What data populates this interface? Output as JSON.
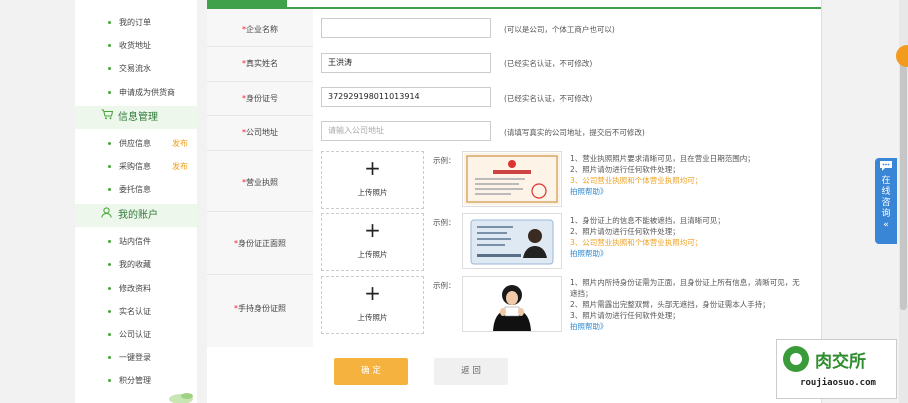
{
  "sidebar": {
    "top_items": [
      {
        "label": "我的订单"
      },
      {
        "label": "收货地址"
      },
      {
        "label": "交易流水"
      },
      {
        "label": "申请成为供货商"
      }
    ],
    "info_section": {
      "heading": "信息管理",
      "icon": "cart-icon",
      "items": [
        {
          "label": "供应信息",
          "action": "发布"
        },
        {
          "label": "采购信息",
          "action": "发布"
        },
        {
          "label": "委托信息",
          "action": ""
        }
      ]
    },
    "account_section": {
      "heading": "我的账户",
      "icon": "user-icon",
      "items": [
        {
          "label": "站内信件"
        },
        {
          "label": "我的收藏"
        },
        {
          "label": "修改资料"
        },
        {
          "label": "实名认证"
        },
        {
          "label": "公司认证"
        },
        {
          "label": "一键登录"
        },
        {
          "label": "积分管理"
        }
      ]
    }
  },
  "form": {
    "company_name": {
      "label": "企业名称",
      "value": "",
      "hint": "(可以是公司，个体工商户也可以)"
    },
    "real_name": {
      "label": "真实姓名",
      "value": "王洪涛",
      "hint": "(已经实名认证，不可修改)"
    },
    "id_number": {
      "label": "身份证号",
      "value": "372929198011013914",
      "hint": "(已经实名认证，不可修改)"
    },
    "company_address": {
      "label": "公司地址",
      "placeholder": "请输入公司地址",
      "hint": "(请填写真实的公司地址，提交后不可修改)"
    },
    "business_license": {
      "label": "营业执照",
      "upload_text": "上传照片",
      "example_label": "示例：",
      "req1": "1、营业执照照片要求清晰可见，且在营业日期范围内；",
      "req2": "2、照片请勿进行任何软件处理；",
      "req3": "3、公司营业执照和个体营业执照均可；",
      "help": "拍照帮助》"
    },
    "id_front": {
      "label": "身份证正面照",
      "upload_text": "上传照片",
      "example_label": "示例：",
      "req1": "1、身份证上的信息不能被遮挡，且清晰可见；",
      "req2": "2、照片请勿进行任何软件处理；",
      "req3": "3、公司营业执照和个体营业执照均可；",
      "help": "拍照帮助》"
    },
    "handheld_id": {
      "label": "手持身份证照",
      "upload_text": "上传照片",
      "example_label": "示例：",
      "req1": "1、照片内所持身份证需为正面，且身份证上所有信息，清晰可见，无遮挡；",
      "req2": "2、照片需露出完整双臂，头部无遮挡，身份证需本人手持；",
      "req3": "3、照片请勿进行任何软件处理；",
      "help": "拍照帮助》"
    },
    "required_mark": "*"
  },
  "buttons": {
    "confirm": "确 定",
    "back": "返 回"
  },
  "widgets": {
    "consult": "在线咨询",
    "consult_arrow": "«",
    "brand_name": "肉交所",
    "brand_url": "roujiaosuo.com"
  },
  "colors": {
    "accent_green": "#3fa14a",
    "confirm_orange": "#f6b23f",
    "link_blue": "#2e88d0",
    "warn_orange": "#f0a020"
  }
}
